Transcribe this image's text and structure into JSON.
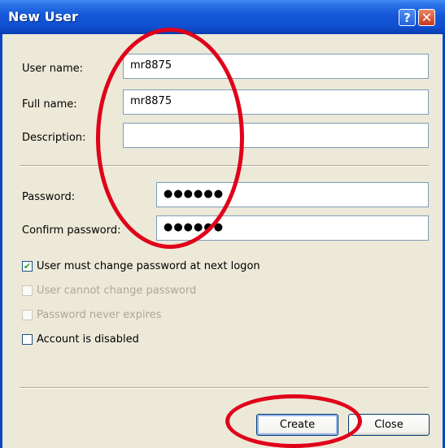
{
  "window": {
    "title": "New User",
    "help_label": "?",
    "close_label": "✕"
  },
  "form": {
    "user_name_label": "User name:",
    "user_name_value": "mr8875",
    "full_name_label": "Full name:",
    "full_name_value": "mr8875",
    "description_label": "Description:",
    "description_value": "",
    "password_label": "Password:",
    "password_value": "●●●●●●",
    "confirm_password_label": "Confirm password:",
    "confirm_password_value": "●●●●●●"
  },
  "options": [
    {
      "label": "User must change password at next logon",
      "checked": true,
      "enabled": true
    },
    {
      "label": "User cannot change password",
      "checked": false,
      "enabled": false
    },
    {
      "label": "Password never expires",
      "checked": false,
      "enabled": false
    },
    {
      "label": "Account is disabled",
      "checked": false,
      "enabled": true
    }
  ],
  "buttons": {
    "create_label": "Create",
    "close_label": "Close"
  },
  "colors": {
    "titlebar": "#0f4fd0",
    "dialog_bg": "#ece9d8",
    "annotation": "#e0001a"
  }
}
